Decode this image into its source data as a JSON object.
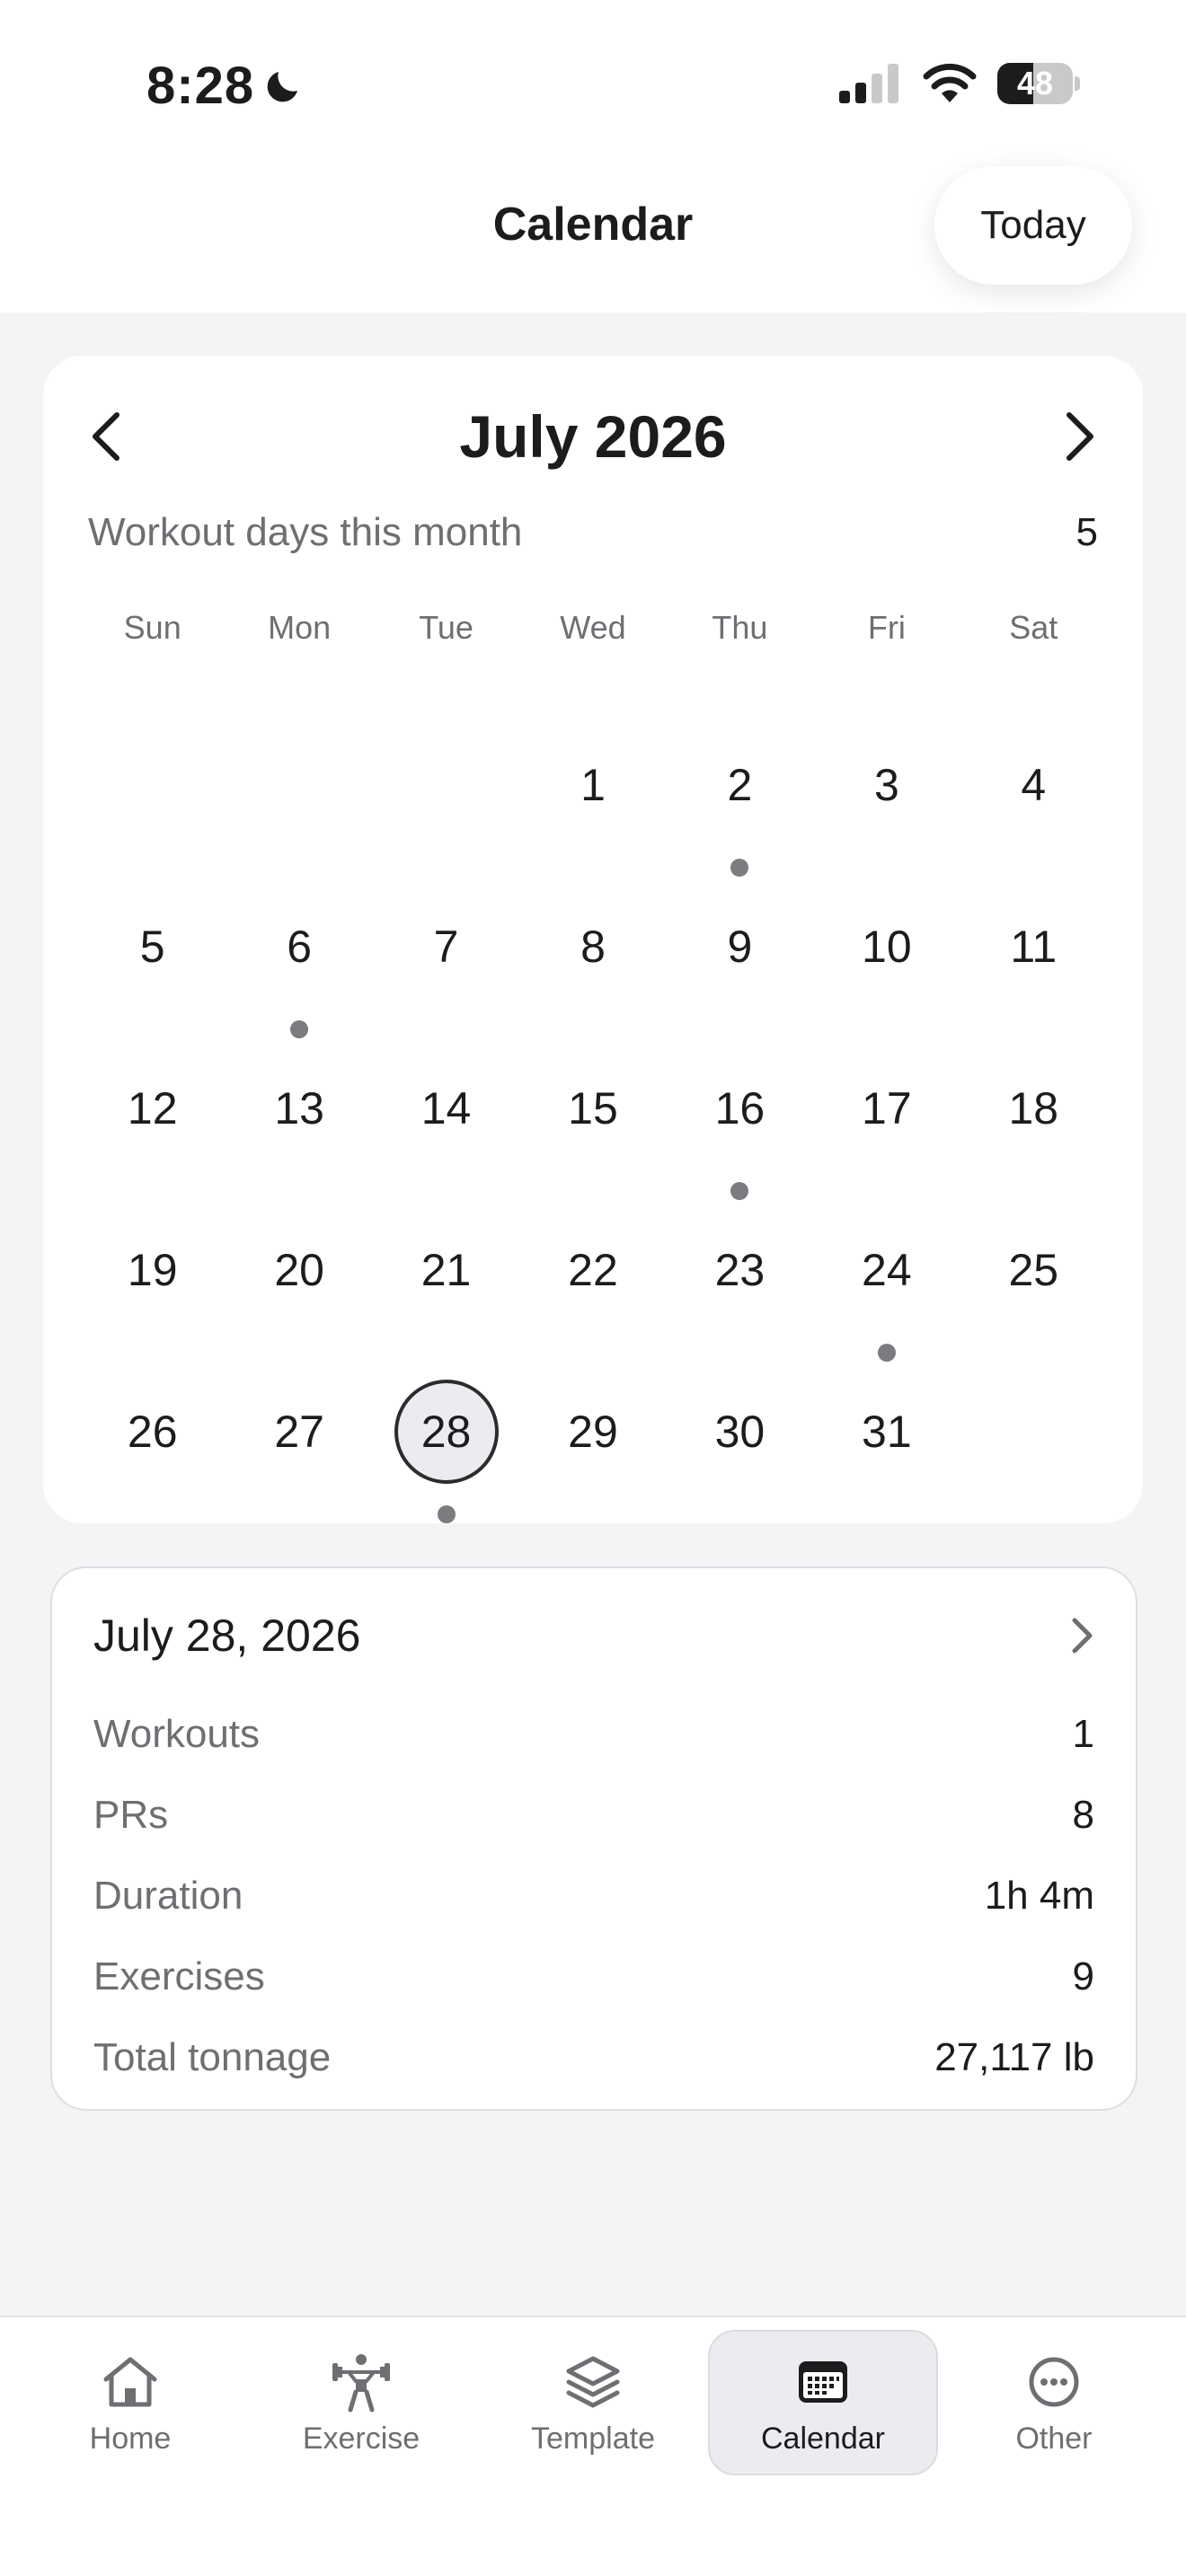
{
  "status_bar": {
    "time": "8:28",
    "battery_level": "48"
  },
  "header": {
    "title": "Calendar",
    "today_label": "Today"
  },
  "calendar": {
    "month_title": "July 2026",
    "workout_days_label": "Workout days this month",
    "workout_days_count": "5",
    "weekdays": [
      "Sun",
      "Mon",
      "Tue",
      "Wed",
      "Thu",
      "Fri",
      "Sat"
    ],
    "leading_blank_days": 3,
    "days": [
      {
        "num": "1",
        "dot": false
      },
      {
        "num": "2",
        "dot": true
      },
      {
        "num": "3",
        "dot": false
      },
      {
        "num": "4",
        "dot": false
      },
      {
        "num": "5",
        "dot": false
      },
      {
        "num": "6",
        "dot": true
      },
      {
        "num": "7",
        "dot": false
      },
      {
        "num": "8",
        "dot": false
      },
      {
        "num": "9",
        "dot": false
      },
      {
        "num": "10",
        "dot": false
      },
      {
        "num": "11",
        "dot": false
      },
      {
        "num": "12",
        "dot": false
      },
      {
        "num": "13",
        "dot": false
      },
      {
        "num": "14",
        "dot": false
      },
      {
        "num": "15",
        "dot": false
      },
      {
        "num": "16",
        "dot": true
      },
      {
        "num": "17",
        "dot": false
      },
      {
        "num": "18",
        "dot": false
      },
      {
        "num": "19",
        "dot": false
      },
      {
        "num": "20",
        "dot": false
      },
      {
        "num": "21",
        "dot": false
      },
      {
        "num": "22",
        "dot": false
      },
      {
        "num": "23",
        "dot": false
      },
      {
        "num": "24",
        "dot": true
      },
      {
        "num": "25",
        "dot": false
      },
      {
        "num": "26",
        "dot": false
      },
      {
        "num": "27",
        "dot": false
      },
      {
        "num": "28",
        "dot": true,
        "selected": true
      },
      {
        "num": "29",
        "dot": false
      },
      {
        "num": "30",
        "dot": false
      },
      {
        "num": "31",
        "dot": false
      }
    ]
  },
  "summary": {
    "date": "July 28, 2026",
    "rows": [
      {
        "label": "Workouts",
        "value": "1"
      },
      {
        "label": "PRs",
        "value": "8"
      },
      {
        "label": "Duration",
        "value": "1h 4m"
      },
      {
        "label": "Exercises",
        "value": "9"
      },
      {
        "label": "Total tonnage",
        "value": "27,117 lb"
      }
    ]
  },
  "tab_bar": {
    "tabs": [
      {
        "label": "Home",
        "icon": "home-icon"
      },
      {
        "label": "Exercise",
        "icon": "weightlifter-icon"
      },
      {
        "label": "Template",
        "icon": "layers-icon"
      },
      {
        "label": "Calendar",
        "icon": "calendar-icon",
        "active": true
      },
      {
        "label": "Other",
        "icon": "more-icon"
      }
    ]
  },
  "colors": {
    "background": "#f4f4f6",
    "card": "#ffffff",
    "text_primary": "#1c1c1e",
    "text_secondary": "#6e6e73",
    "dot": "#7c7c80",
    "active_tab": "#ececf0"
  }
}
